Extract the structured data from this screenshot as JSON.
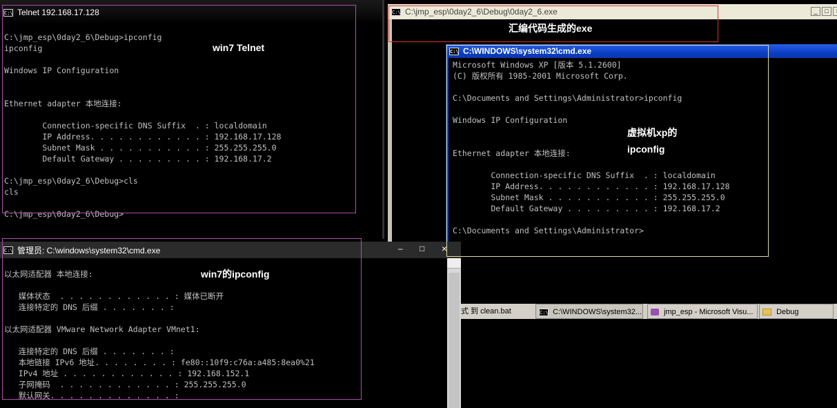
{
  "telnet_window": {
    "title": "Telnet 192.168.17.128",
    "lines": [
      "",
      "C:\\jmp_esp\\0day2_6\\Debug>ipconfig",
      "ipconfig",
      "",
      "Windows IP Configuration",
      "",
      "",
      "Ethernet adapter 本地连接:",
      "",
      "        Connection-specific DNS Suffix  . : localdomain",
      "        IP Address. . . . . . . . . . . . : 192.168.17.128",
      "        Subnet Mask . . . . . . . . . . . : 255.255.255.0",
      "        Default Gateway . . . . . . . . . : 192.168.17.2",
      "",
      "C:\\jmp_esp\\0day2_6\\Debug>cls",
      "cls",
      "",
      "C:\\jmp_esp\\0day2_6\\Debug>"
    ]
  },
  "annotations": {
    "win7_telnet": "win7 Telnet",
    "asm_exe": "汇编代码生成的exe",
    "vm_xp_line1": "虚拟机xp的",
    "vm_xp_line2": "ipconfig",
    "win7_ipconfig": "win7的ipconfig"
  },
  "exe_window": {
    "title": "C:\\jmp_esp\\0day2_6\\Debug\\0day2_6.exe",
    "buttons": [
      "_",
      "□",
      "×"
    ]
  },
  "xp_cmd_window": {
    "title": "C:\\WINDOWS\\system32\\cmd.exe",
    "lines": [
      "Microsoft Windows XP [版本 5.1.2600]",
      "(C) 版权所有 1985-2001 Microsoft Corp.",
      "",
      "C:\\Documents and Settings\\Administrator>ipconfig",
      "",
      "Windows IP Configuration",
      "",
      "",
      "Ethernet adapter 本地连接:",
      "",
      "        Connection-specific DNS Suffix  . : localdomain",
      "        IP Address. . . . . . . . . . . . : 192.168.17.128",
      "        Subnet Mask . . . . . . . . . . . : 255.255.255.0",
      "        Default Gateway . . . . . . . . . : 192.168.17.2",
      "",
      "C:\\Documents and Settings\\Administrator>"
    ]
  },
  "win7_cmd_window": {
    "title": "管理员: C:\\windows\\system32\\cmd.exe",
    "buttons": [
      "–",
      "□",
      "×"
    ],
    "lines": [
      "以太网适配器 本地连接:",
      "",
      "   媒体状态  . . . . . . . . . . . . : 媒体已断开",
      "   连接特定的 DNS 后缀 . . . . . . . :",
      "",
      "以太网适配器 VMware Network Adapter VMnet1:",
      "",
      "   连接特定的 DNS 后缀 . . . . . . . :",
      "   本地链接 IPv6 地址. . . . . . . . : fe80::10f9:c76a:a485:8ea0%21",
      "   IPv4 地址 . . . . . . . . . . . . : 192.168.152.1",
      "   子网掩码  . . . . . . . . . . . . : 255.255.255.0",
      "   默认网关. . . . . . . . . . . . . :"
    ]
  },
  "taskbar": {
    "items": [
      {
        "label": "式 到 clean.bat",
        "icon": "batch-file-icon"
      },
      {
        "label": "C:\\WINDOWS\\system32...",
        "icon": "cmd-icon"
      },
      {
        "label": "jmp_esp - Microsoft Visu...",
        "icon": "visual-studio-icon"
      },
      {
        "label": "Debug",
        "icon": "folder-icon"
      }
    ]
  },
  "colors": {
    "console_text": "#c0c0c0",
    "annotation_pink": "#b050b0",
    "annotation_red": "#e03030",
    "annotation_yellow": "#e0e0a0"
  }
}
